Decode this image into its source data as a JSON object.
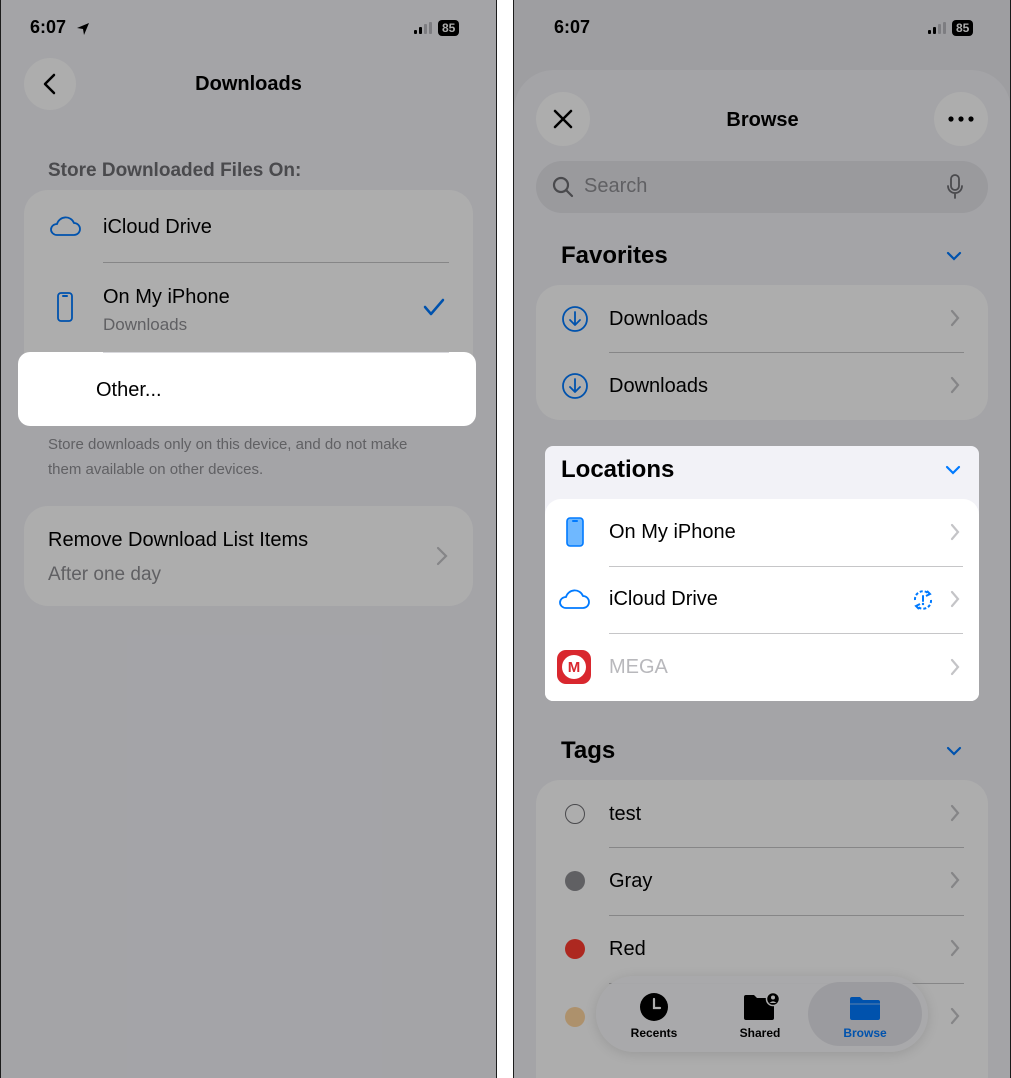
{
  "left": {
    "status": {
      "time": "6:07",
      "battery": "85"
    },
    "nav": {
      "title": "Downloads"
    },
    "store_header": "Store Downloaded Files On:",
    "options": {
      "icloud": {
        "label": "iCloud Drive"
      },
      "iphone": {
        "label": "On My iPhone",
        "sublabel": "Downloads"
      },
      "other": {
        "label": "Other..."
      }
    },
    "footnote_line1": "Store downloads only on this device, and do not make",
    "footnote_line2": "them available on other devices.",
    "remove": {
      "label": "Remove Download List Items",
      "value": "After one day"
    }
  },
  "right": {
    "status": {
      "time": "6:07",
      "battery": "85"
    },
    "nav": {
      "title": "Browse"
    },
    "search": {
      "placeholder": "Search"
    },
    "favorites": {
      "title": "Favorites",
      "items": [
        {
          "label": "Downloads"
        },
        {
          "label": "Downloads"
        }
      ]
    },
    "locations": {
      "title": "Locations",
      "items": [
        {
          "label": "On My iPhone"
        },
        {
          "label": "iCloud Drive"
        },
        {
          "label": "MEGA"
        }
      ]
    },
    "tags": {
      "title": "Tags",
      "items": [
        {
          "label": "test",
          "color": "#ffffff"
        },
        {
          "label": "Gray",
          "color": "#8e8e93"
        },
        {
          "label": "Red",
          "color": "#ff3b30"
        },
        {
          "label": "",
          "color": "#ffd6a0"
        }
      ]
    },
    "tabbar": {
      "items": [
        {
          "label": "Recents"
        },
        {
          "label": "Shared"
        },
        {
          "label": "Browse"
        }
      ]
    }
  },
  "colors": {
    "accent": "#007aff",
    "mega_red": "#d9272e",
    "background": "#f2f2f7"
  }
}
